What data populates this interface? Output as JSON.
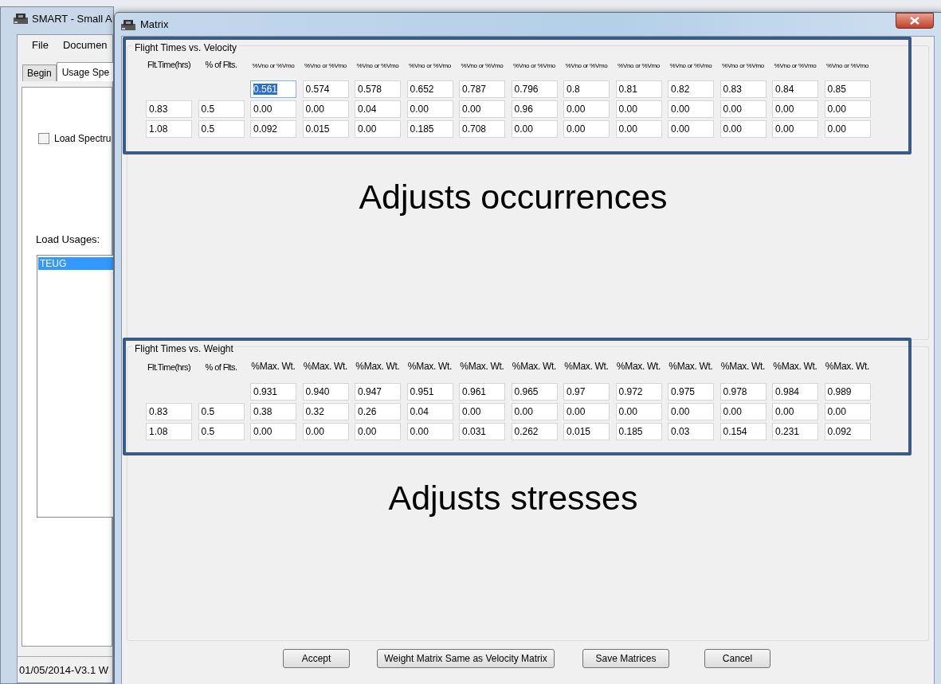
{
  "main_window": {
    "title": "SMART - Small A",
    "menu": [
      "File",
      "Documen"
    ],
    "tabs": [
      {
        "label": "Begin",
        "selected": false
      },
      {
        "label": "Usage Spe",
        "selected": true
      }
    ],
    "checkbox": {
      "label": "Load Spectru",
      "checked": false
    },
    "load_usages_label": "Load Usages:",
    "load_usages": [
      {
        "label": "TEUG",
        "selected": true
      }
    ],
    "status": "01/05/2014-V3.1 W"
  },
  "dialog": {
    "title": "Matrix",
    "groups": [
      {
        "kind": "velocity",
        "title": "Flight Times vs. Velocity",
        "annotation": "Adjusts occurrences",
        "row_headers": [
          "Flt.Time(hrs)",
          "% of Flts."
        ],
        "columns": [
          "%Vno or %Vmo",
          "%Vno or %Vmo",
          "%Vno or %Vmo",
          "%Vno or %Vmo",
          "%Vno or %Vmo",
          "%Vno or %Vmo",
          "%Vno or %Vmo",
          "%Vno or %Vmo",
          "%Vno or %Vmo",
          "%Vno or %Vmo",
          "%Vno or %Vmo",
          "%Vno or %Vmo"
        ],
        "column_values": [
          {
            "value": "0.561",
            "selected": true
          },
          {
            "value": "0.574",
            "selected": false
          },
          {
            "value": "0.578",
            "selected": false
          },
          {
            "value": "0.652",
            "selected": false
          },
          {
            "value": "0.787",
            "selected": false
          },
          {
            "value": "0.796",
            "selected": false
          },
          {
            "value": "0.8",
            "selected": false
          },
          {
            "value": "0.81",
            "selected": false
          },
          {
            "value": "0.82",
            "selected": false
          },
          {
            "value": "0.83",
            "selected": false
          },
          {
            "value": "0.84",
            "selected": false
          },
          {
            "value": "0.85",
            "selected": false
          }
        ],
        "rows": [
          {
            "flight_time": "0.83",
            "share": "0.5",
            "values": [
              "0.00",
              "0.00",
              "0.04",
              "0.00",
              "0.00",
              "0.96",
              "0.00",
              "0.00",
              "0.00",
              "0.00",
              "0.00",
              "0.00"
            ]
          },
          {
            "flight_time": "1.08",
            "share": "0.5",
            "values": [
              "0.092",
              "0.015",
              "0.00",
              "0.185",
              "0.708",
              "0.00",
              "0.00",
              "0.00",
              "0.00",
              "0.00",
              "0.00",
              "0.00"
            ]
          }
        ]
      },
      {
        "kind": "weight",
        "title": "Flight Times vs. Weight",
        "annotation": "Adjusts stresses",
        "row_headers": [
          "Flt.Time(hrs)",
          "% of Flts."
        ],
        "columns": [
          "%Max. Wt.",
          "%Max. Wt.",
          "%Max. Wt.",
          "%Max. Wt.",
          "%Max. Wt.",
          "%Max. Wt.",
          "%Max. Wt.",
          "%Max. Wt.",
          "%Max. Wt.",
          "%Max. Wt.",
          "%Max. Wt.",
          "%Max. Wt."
        ],
        "column_values": [
          {
            "value": "0.931",
            "selected": false
          },
          {
            "value": "0.940",
            "selected": false
          },
          {
            "value": "0.947",
            "selected": false
          },
          {
            "value": "0.951",
            "selected": false
          },
          {
            "value": "0.961",
            "selected": false
          },
          {
            "value": "0.965",
            "selected": false
          },
          {
            "value": "0.97",
            "selected": false
          },
          {
            "value": "0.972",
            "selected": false
          },
          {
            "value": "0.975",
            "selected": false
          },
          {
            "value": "0.978",
            "selected": false
          },
          {
            "value": "0.984",
            "selected": false
          },
          {
            "value": "0.989",
            "selected": false
          }
        ],
        "rows": [
          {
            "flight_time": "0.83",
            "share": "0.5",
            "values": [
              "0.38",
              "0.32",
              "0.26",
              "0.04",
              "0.00",
              "0.00",
              "0.00",
              "0.00",
              "0.00",
              "0.00",
              "0.00",
              "0.00"
            ]
          },
          {
            "flight_time": "1.08",
            "share": "0.5",
            "values": [
              "0.00",
              "0.00",
              "0.00",
              "0.00",
              "0.031",
              "0.262",
              "0.015",
              "0.185",
              "0.03",
              "0.154",
              "0.231",
              "0.092"
            ]
          }
        ]
      }
    ],
    "buttons": [
      "Accept",
      "Weight Matrix Same as Velocity Matrix",
      "Save Matrices",
      "Cancel"
    ]
  }
}
